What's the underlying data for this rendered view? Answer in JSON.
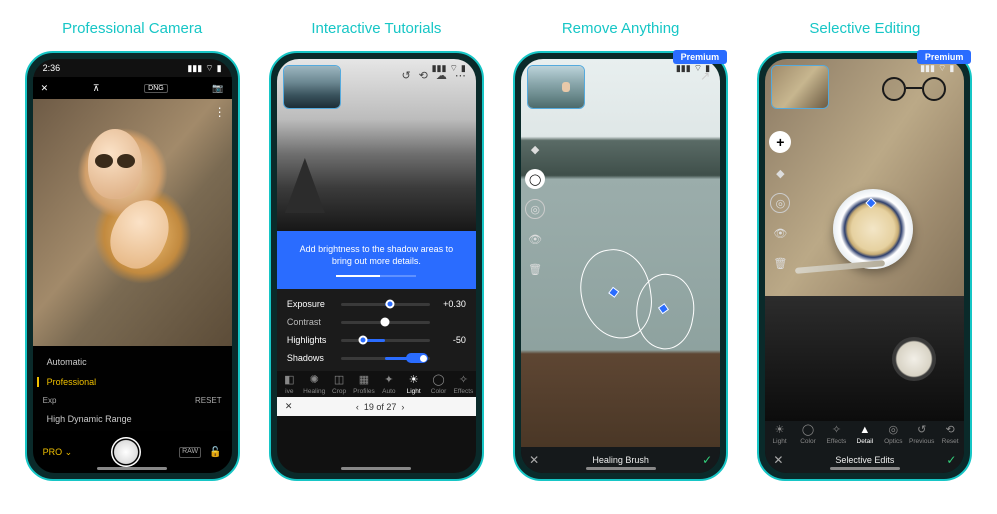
{
  "cards": [
    {
      "title": "Professional Camera",
      "premium": false
    },
    {
      "title": "Interactive Tutorials",
      "premium": false
    },
    {
      "title": "Remove Anything",
      "premium": true
    },
    {
      "title": "Selective Editing",
      "premium": true
    }
  ],
  "premium_label": "Premium",
  "status": {
    "time": "2:36",
    "signal": "▪▪▪",
    "wifi": "⋮",
    "battery": "▮"
  },
  "camera": {
    "close": "✕",
    "format": "DNG",
    "camera_icon": "📷",
    "menu": "⋮",
    "modes": {
      "auto": "Automatic",
      "pro": "Professional",
      "hdr": "High Dynamic Range"
    },
    "exp_label": "Exp",
    "reset_label": "RESET",
    "pro_label": "PRO",
    "pro_chevron": "⌄",
    "raw_badge": "RAW",
    "lock_icon": "🔓"
  },
  "tutorial": {
    "top_icons": {
      "undo": "↺",
      "back": "⟲",
      "cloud": "☁",
      "more": "⋯"
    },
    "tip": "Add brightness to the shadow areas to bring out more details.",
    "sliders": [
      {
        "name": "Exposure",
        "value": "+0.30",
        "pos": 55,
        "active": true,
        "fill_from": 50
      },
      {
        "name": "Contrast",
        "value": "",
        "pos": 50,
        "active": false,
        "fill_from": 50
      },
      {
        "name": "Highlights",
        "value": "-50",
        "pos": 25,
        "active": true,
        "fill_from": 50
      },
      {
        "name": "Shadows",
        "value": "",
        "pos": 98,
        "active": true,
        "fill_from": 50,
        "pill": true
      }
    ],
    "tools": [
      {
        "label": "ive",
        "icon": "◧"
      },
      {
        "label": "Healing",
        "icon": "✺"
      },
      {
        "label": "Crop",
        "icon": "◫"
      },
      {
        "label": "Profiles",
        "icon": "▦"
      },
      {
        "label": "Auto",
        "icon": "✦"
      },
      {
        "label": "Light",
        "icon": "☀",
        "active": true
      },
      {
        "label": "Color",
        "icon": "◯"
      },
      {
        "label": "Effects",
        "icon": "✧"
      }
    ],
    "pager": {
      "x": "✕",
      "prev": "‹",
      "label": "19 of 27",
      "next": "›"
    }
  },
  "healing": {
    "share_icon": "↗",
    "side": {
      "spot": "◆",
      "brush": "◯",
      "clone": "◎",
      "eye": "👁",
      "trash": "🗑"
    },
    "bar": {
      "x": "✕",
      "title": "Healing Brush",
      "ok": "✓"
    }
  },
  "selective": {
    "side": {
      "add": "+",
      "spot": "◆",
      "ring": "◎",
      "eye": "👁",
      "trash": "🗑"
    },
    "tools": [
      {
        "label": "Light",
        "icon": "☀"
      },
      {
        "label": "Color",
        "icon": "◯"
      },
      {
        "label": "Effects",
        "icon": "✧"
      },
      {
        "label": "Detail",
        "icon": "▲",
        "active": true
      },
      {
        "label": "Optics",
        "icon": "◎"
      },
      {
        "label": "Previous",
        "icon": "↺"
      },
      {
        "label": "Reset",
        "icon": "⟲"
      }
    ],
    "bar": {
      "x": "✕",
      "title": "Selective Edits",
      "ok": "✓"
    }
  }
}
